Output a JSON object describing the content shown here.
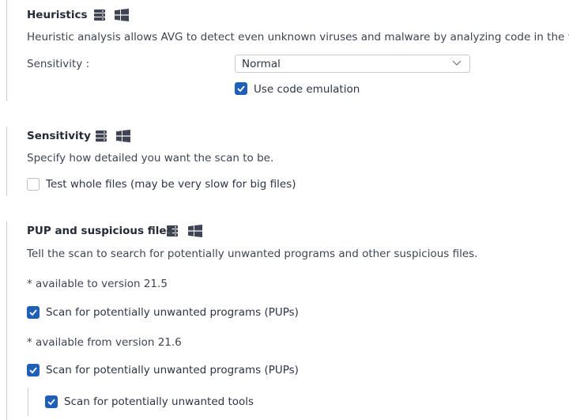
{
  "heuristics": {
    "title": "Heuristics",
    "description": "Heuristic analysis allows AVG to detect even unknown viruses and malware by analyzing code in the file.",
    "sensitivity_label": "Sensitivity :",
    "sensitivity_value": "Normal",
    "code_emulation_label": "Use code emulation",
    "code_emulation_checked": true
  },
  "sensitivity": {
    "title": "Sensitivity",
    "description": "Specify how detailed you want the scan to be.",
    "whole_files_label": "Test whole files (may be very slow for big files)",
    "whole_files_checked": false
  },
  "pup": {
    "title": "PUP and suspicious files",
    "description": "Tell the scan to search for potentially unwanted programs and other suspicious files.",
    "note_v215": "* available to version 21.5",
    "pup_label_old": "Scan for potentially unwanted programs (PUPs)",
    "note_v216": "* available from version 21.6",
    "pup_label_new": "Scan for potentially unwanted programs (PUPs)",
    "tools_label": "Scan for potentially unwanted tools"
  },
  "icons": {
    "server": "server-icon",
    "windows": "windows-icon",
    "checkmark": "checkmark-icon",
    "chevron": "chevron-down-icon"
  },
  "colors": {
    "accent": "#1f5fb8",
    "border": "#c8ccd2",
    "text": "#2d3445"
  }
}
